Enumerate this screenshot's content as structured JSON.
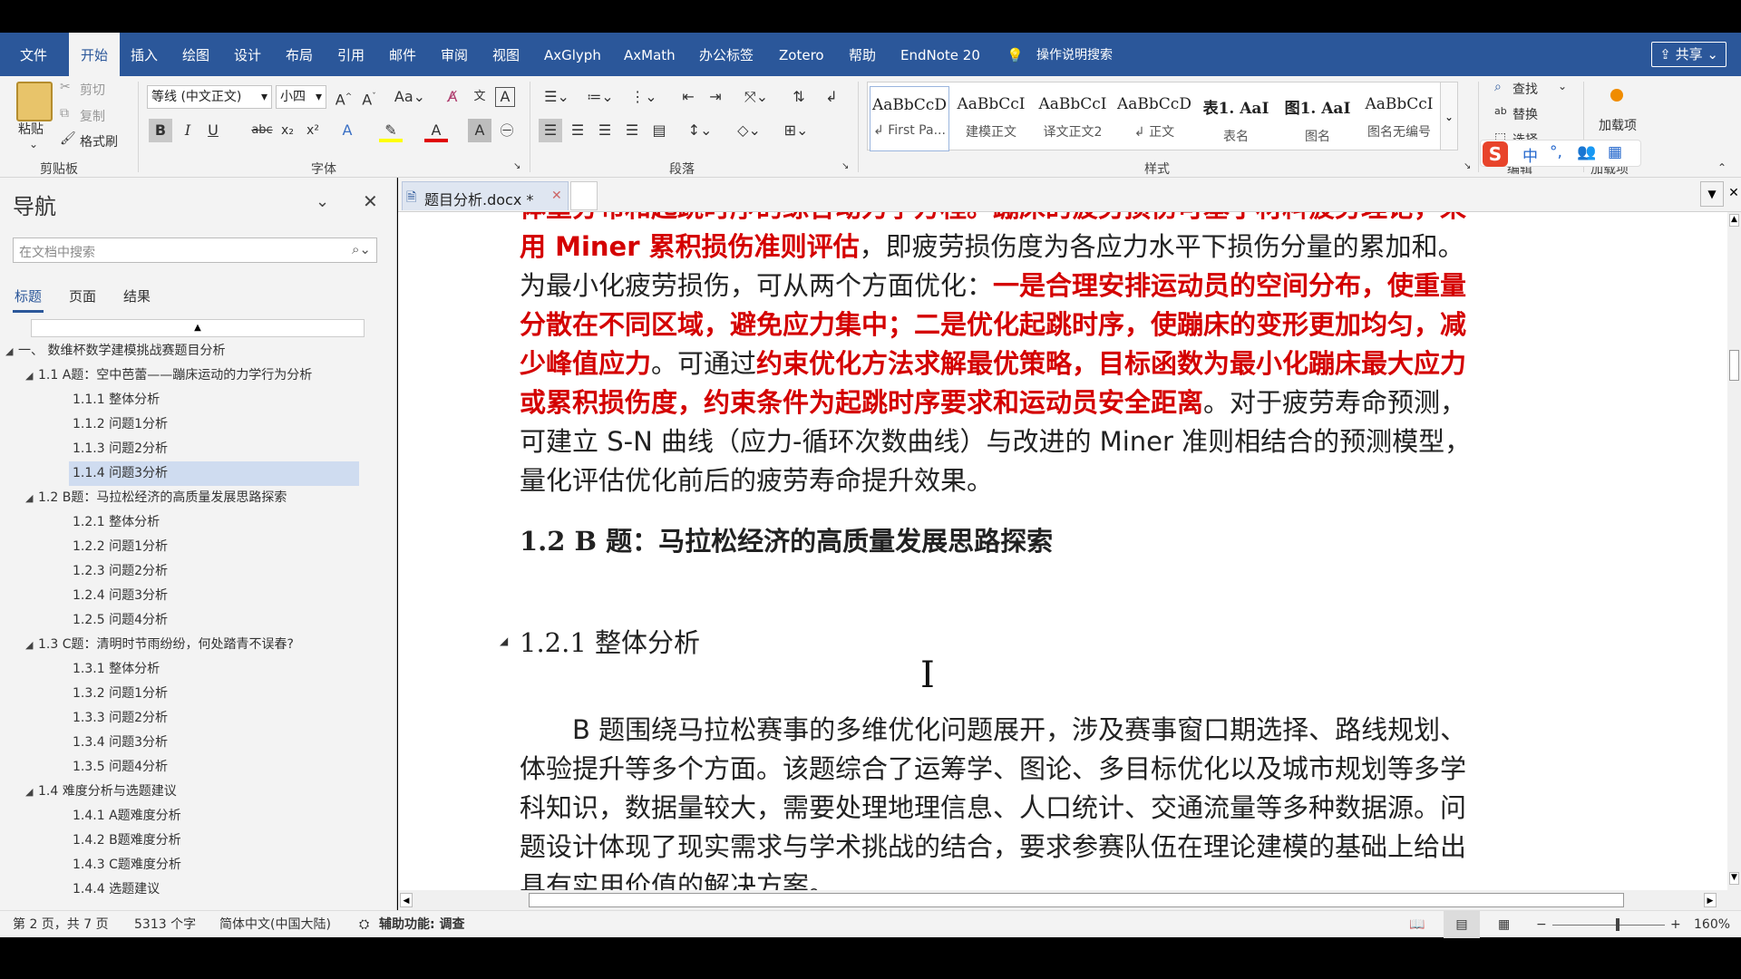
{
  "ribbon_tabs": [
    "文件",
    "开始",
    "插入",
    "绘图",
    "设计",
    "布局",
    "引用",
    "邮件",
    "审阅",
    "视图",
    "AxGlyph",
    "AxMath",
    "办公标签",
    "Zotero",
    "帮助",
    "EndNote 20"
  ],
  "active_tab": "开始",
  "tell_me": "操作说明搜索",
  "share_label": "共享",
  "clipboard": {
    "paste": "粘贴",
    "cut": "剪切",
    "copy": "复制",
    "format_painter": "格式刷",
    "group": "剪贴板"
  },
  "font": {
    "name": "等线 (中文正文)",
    "size": "小四",
    "group": "字体"
  },
  "paragraph_group": "段落",
  "styles": {
    "group": "样式",
    "items": [
      {
        "sample": "AaBbCcD",
        "name": "↲ First Pa..."
      },
      {
        "sample": "AaBbCcI",
        "name": "建模正文"
      },
      {
        "sample": "AaBbCcI",
        "name": "译文正文2"
      },
      {
        "sample": "AaBbCcD",
        "name": "↲ 正文"
      },
      {
        "sample": "表1. AaI",
        "name": "表名"
      },
      {
        "sample": "图1. AaI",
        "name": "图名"
      },
      {
        "sample": "AaBbCcI",
        "name": "图名无编号"
      }
    ]
  },
  "editing": {
    "find": "查找",
    "replace": "替换",
    "select": "选择",
    "group": "编辑"
  },
  "addins": {
    "label": "加载项",
    "group": "加载项"
  },
  "nav": {
    "title": "导航",
    "search_placeholder": "在文档中搜索",
    "tabs": [
      "标题",
      "页面",
      "结果"
    ],
    "items": [
      {
        "level": 1,
        "text": "一、 数维杯数学建模挑战赛题目分析",
        "expand": "◢"
      },
      {
        "level": 2,
        "text": "1.1 A题：空中芭蕾——蹦床运动的力学行为分析",
        "expand": "◢"
      },
      {
        "level": 3,
        "text": "1.1.1 整体分析"
      },
      {
        "level": 3,
        "text": "1.1.2 问题1分析"
      },
      {
        "level": 3,
        "text": "1.1.3 问题2分析"
      },
      {
        "level": 3,
        "text": "1.1.4 问题3分析",
        "selected": true
      },
      {
        "level": 2,
        "text": "1.2 B题：马拉松经济的高质量发展思路探索",
        "expand": "◢"
      },
      {
        "level": 3,
        "text": "1.2.1 整体分析"
      },
      {
        "level": 3,
        "text": "1.2.2 问题1分析"
      },
      {
        "level": 3,
        "text": "1.2.3 问题2分析"
      },
      {
        "level": 3,
        "text": "1.2.4 问题3分析"
      },
      {
        "level": 3,
        "text": "1.2.5 问题4分析"
      },
      {
        "level": 2,
        "text": "1.3 C题：清明时节雨纷纷，何处踏青不误春?",
        "expand": "◢"
      },
      {
        "level": 3,
        "text": "1.3.1 整体分析"
      },
      {
        "level": 3,
        "text": "1.3.2 问题1分析"
      },
      {
        "level": 3,
        "text": "1.3.3 问题2分析"
      },
      {
        "level": 3,
        "text": "1.3.4 问题3分析"
      },
      {
        "level": 3,
        "text": "1.3.5 问题4分析"
      },
      {
        "level": 2,
        "text": "1.4 难度分析与选题建议",
        "expand": "◢"
      },
      {
        "level": 3,
        "text": "1.4.1 A题难度分析"
      },
      {
        "level": 3,
        "text": "1.4.2 B题难度分析"
      },
      {
        "level": 3,
        "text": "1.4.3 C题难度分析"
      },
      {
        "level": 3,
        "text": "1.4.4 选题建议"
      }
    ]
  },
  "doc_tab": "题目分析.docx *",
  "doc": {
    "line0": "体重分布和起跳时序的综合动力学方程。蹦床的疲劳损伤可基于材料疲劳理论，采",
    "line1_red": "用 Miner 累积损伤准则评估",
    "line1_rest": "，即疲劳损伤度为各应力水平下损伤分量的累加和。",
    "line2_normal": "为最小化疲劳损伤，可从两个方面优化：",
    "line2_red": "一是合理安排运动员的空间分布，使重量",
    "line3_red": "分散在不同区域，避免应力集中；二是优化起跳时序，使蹦床的变形更加均匀，减",
    "line4_red": "少峰值应力",
    "line4_normal": "。可通过",
    "line4_red2": "约束优化方法求解最优策略，目标函数为最小化蹦床最大应力",
    "line5_red": "或累积损伤度，约束条件为起跳时序要求和运动员安全距离",
    "line5_normal": "。对于疲劳寿命预测，",
    "line6": "可建立 S-N 曲线（应力-循环次数曲线）与改进的 Miner 准则相结合的预测模型，",
    "line7": "量化评估优化前后的疲劳寿命提升效果。",
    "heading2": "1.2 B 题：马拉松经济的高质量发展思路探索",
    "heading3": "1.2.1 整体分析",
    "body1": "B 题围绕马拉松赛事的多维优化问题展开，涉及赛事窗口期选择、路线规划、",
    "body2": "体验提升等多个方面。该题综合了运筹学、图论、多目标优化以及城市规划等多学",
    "body3": "科知识，数据量较大，需要处理地理信息、人口统计、交通流量等多种数据源。问",
    "body4": "题设计体现了现实需求与学术挑战的结合，要求参赛队伍在理论建模的基础上给出",
    "body5": "具有实用价值的解决方案。"
  },
  "status": {
    "page": "第 2 页，共 7 页",
    "words": "5313 个字",
    "lang": "简体中文(中国大陆)",
    "access": "辅助功能: 调查",
    "zoom": "160%"
  },
  "colors": {
    "ribbon_blue": "#2b579a",
    "red_text": "#d40000"
  }
}
